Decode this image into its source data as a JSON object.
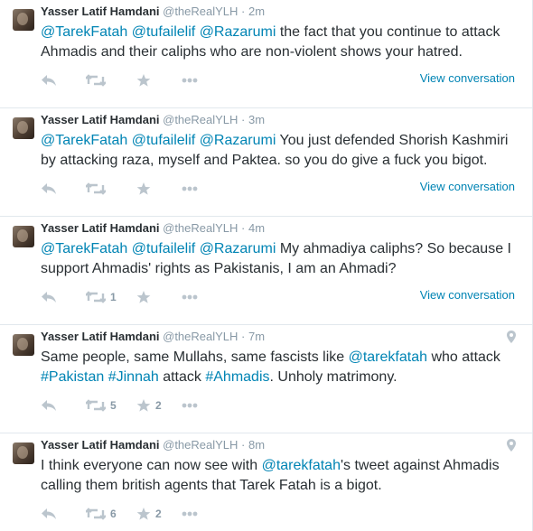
{
  "tweets": [
    {
      "fullname": "Yasser Latif Hamdani",
      "username": "@theRealYLH",
      "separator": "·",
      "time": "2m",
      "segments": [
        {
          "type": "mention",
          "text": "@TarekFatah"
        },
        {
          "type": "text",
          "text": " "
        },
        {
          "type": "mention",
          "text": "@tufailelif"
        },
        {
          "type": "text",
          "text": " "
        },
        {
          "type": "mention",
          "text": "@Razarumi"
        },
        {
          "type": "text",
          "text": " the fact that you continue to attack Ahmadis and their caliphs who are non-violent shows your hatred."
        }
      ],
      "retweet_count": "",
      "favorite_count": "",
      "view_conversation": "View conversation",
      "has_location": false
    },
    {
      "fullname": "Yasser Latif Hamdani",
      "username": "@theRealYLH",
      "separator": "·",
      "time": "3m",
      "segments": [
        {
          "type": "mention",
          "text": "@TarekFatah"
        },
        {
          "type": "text",
          "text": " "
        },
        {
          "type": "mention",
          "text": "@tufailelif"
        },
        {
          "type": "text",
          "text": " "
        },
        {
          "type": "mention",
          "text": "@Razarumi"
        },
        {
          "type": "text",
          "text": " You just defended Shorish Kashmiri by attacking raza, myself and Paktea. so you do give a fuck you bigot."
        }
      ],
      "retweet_count": "",
      "favorite_count": "",
      "view_conversation": "View conversation",
      "has_location": false
    },
    {
      "fullname": "Yasser Latif Hamdani",
      "username": "@theRealYLH",
      "separator": "·",
      "time": "4m",
      "segments": [
        {
          "type": "mention",
          "text": "@TarekFatah"
        },
        {
          "type": "text",
          "text": " "
        },
        {
          "type": "mention",
          "text": "@tufailelif"
        },
        {
          "type": "text",
          "text": " "
        },
        {
          "type": "mention",
          "text": "@Razarumi"
        },
        {
          "type": "text",
          "text": " My ahmadiya caliphs? So because I support Ahmadis' rights as Pakistanis, I am an Ahmadi?"
        }
      ],
      "retweet_count": "1",
      "favorite_count": "",
      "view_conversation": "View conversation",
      "has_location": false
    },
    {
      "fullname": "Yasser Latif Hamdani",
      "username": "@theRealYLH",
      "separator": "·",
      "time": "7m",
      "segments": [
        {
          "type": "text",
          "text": "Same people, same Mullahs, same fascists like "
        },
        {
          "type": "mention",
          "text": "@tarekfatah"
        },
        {
          "type": "text",
          "text": " who attack "
        },
        {
          "type": "hashtag",
          "text": "#Pakistan"
        },
        {
          "type": "text",
          "text": " "
        },
        {
          "type": "hashtag",
          "text": "#Jinnah"
        },
        {
          "type": "text",
          "text": " attack "
        },
        {
          "type": "hashtag",
          "text": "#Ahmadis"
        },
        {
          "type": "text",
          "text": ".  Unholy matrimony."
        }
      ],
      "retweet_count": "5",
      "favorite_count": "2",
      "view_conversation": "",
      "has_location": true
    },
    {
      "fullname": "Yasser Latif Hamdani",
      "username": "@theRealYLH",
      "separator": "·",
      "time": "8m",
      "segments": [
        {
          "type": "text",
          "text": "I think everyone can now see with "
        },
        {
          "type": "mention",
          "text": "@tarekfatah"
        },
        {
          "type": "text",
          "text": "'s tweet against Ahmadis calling them british agents that Tarek Fatah is a bigot."
        }
      ],
      "retweet_count": "6",
      "favorite_count": "2",
      "view_conversation": "",
      "has_location": true
    }
  ],
  "icons": {
    "reply": "reply-icon",
    "retweet": "retweet-icon",
    "favorite": "star-icon",
    "more": "more-icon",
    "location": "location-pin-icon"
  },
  "colors": {
    "link": "#0084b4",
    "meta": "#8899a6",
    "text": "#292f33",
    "icon": "#bbc5cd",
    "border": "#e1e8ed"
  }
}
